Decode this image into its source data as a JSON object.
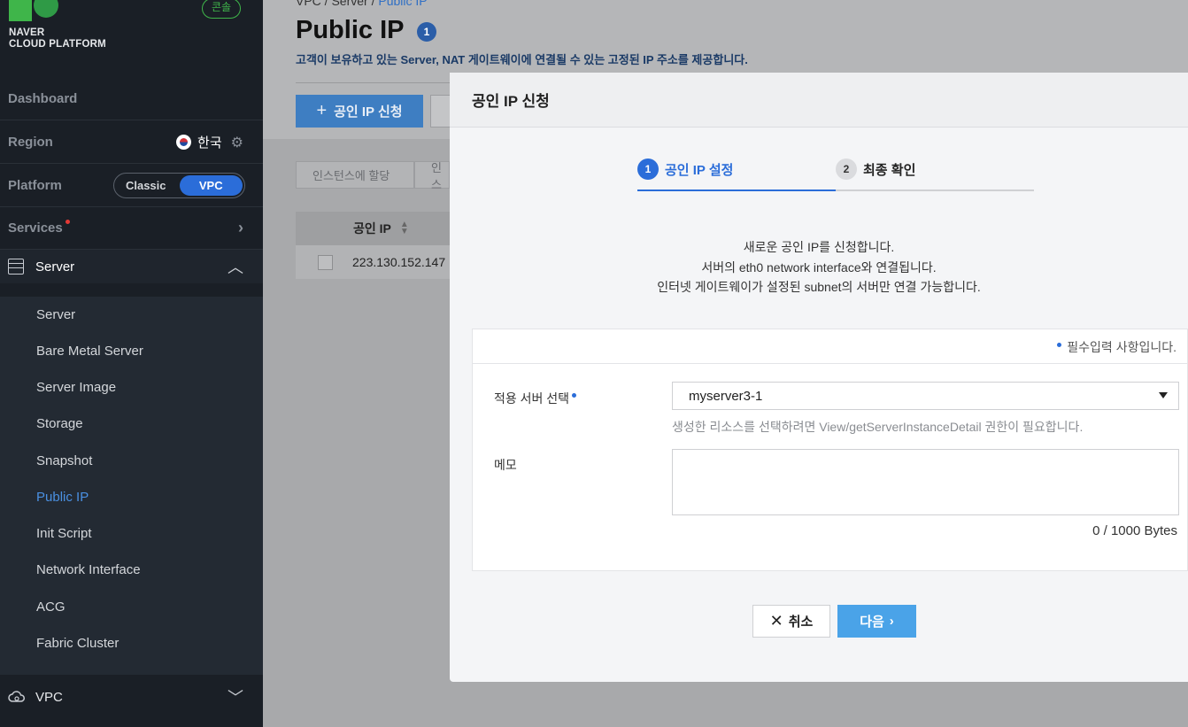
{
  "sidebar": {
    "brand_line1": "NAVER",
    "brand_line2": "CLOUD PLATFORM",
    "console_badge": "콘솔",
    "dashboard": "Dashboard",
    "region_label": "Region",
    "region_value": "한국",
    "platform_label": "Platform",
    "platform_options": [
      "Classic",
      "VPC"
    ],
    "platform_selected": "VPC",
    "services_label": "Services",
    "server_section": "Server",
    "server_items": [
      "Server",
      "Bare Metal Server",
      "Server Image",
      "Storage",
      "Snapshot",
      "Public IP",
      "Init Script",
      "Network Interface",
      "ACG",
      "Fabric Cluster"
    ],
    "active_item": "Public IP",
    "vpc_section": "VPC"
  },
  "main": {
    "breadcrumb": [
      "VPC",
      "Server",
      "Public IP"
    ],
    "title": "Public IP",
    "title_badge": "1",
    "description": "고객이 보유하고 있는 Server, NAT 게이트웨이에 연결될 수 있는 고정된 IP 주소를 제공합니다.",
    "apply_button": "공인 IP 신청",
    "filter_tabs": [
      "인스턴스에 할당",
      "인스"
    ],
    "table_header": "공인 IP",
    "table_rows": [
      "223.130.152.147"
    ]
  },
  "modal": {
    "title": "공인 IP 신청",
    "steps": [
      {
        "num": "1",
        "label": "공인 IP 설정"
      },
      {
        "num": "2",
        "label": "최종 확인"
      }
    ],
    "intro_lines": [
      "새로운 공인 IP를 신청합니다.",
      "서버의 eth0 network interface와 연결됩니다.",
      "인터넷 게이트웨이가 설정된 subnet의 서버만 연결 가능합니다."
    ],
    "required_note": "필수입력 사항입니다.",
    "server_field_label": "적용 서버 선택",
    "server_field_value": "myserver3-1",
    "server_hint": "생성한 리소스를 선택하려면 View/getServerInstanceDetail 권한이 필요합니다.",
    "memo_label": "메모",
    "memo_value": "",
    "byte_count": "0 / 1000 Bytes",
    "cancel_button": "취소",
    "next_button": "다음"
  },
  "colors": {
    "sidebar_bg": "#1a1f26",
    "accent_blue": "#2b6dd9",
    "brand_green": "#3fb54a",
    "next_button": "#4aa3e8"
  }
}
